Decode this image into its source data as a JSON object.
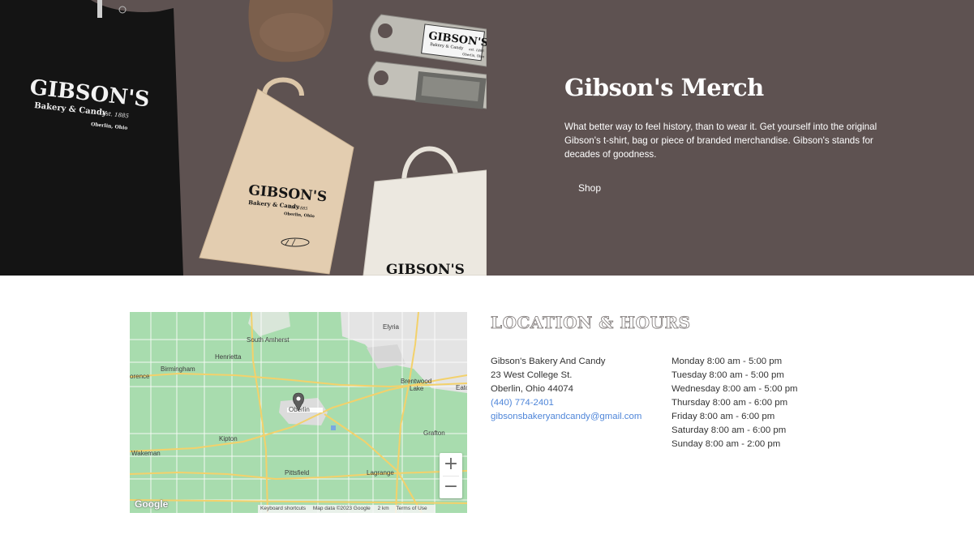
{
  "merch": {
    "title": "Gibson's Merch",
    "description": "What better way to feel history, than to wear it. Get yourself into the original Gibson's t-shirt, bag or piece of branded merchandise. Gibson's stands for decades of goodness.",
    "shop_label": "Shop",
    "image_text": {
      "shirt_brand": "GIBSON'S",
      "shirt_sub": "Bakery & Candy",
      "shirt_est": "est. 1885",
      "shirt_city": "Oberlin, Ohio",
      "tote_brand": "GIBSON'S",
      "tote_sub": "Bakery & Candy",
      "tote_est": "est. 1885",
      "tote_city": "Oberlin, Ohio",
      "opener_brand": "GIBSON'S",
      "opener_sub": "Bakery & Candy",
      "opener_est": "est. 1885",
      "opener_city": "Oberlin, Ohio",
      "tote2_brand": "GIBSON'S"
    },
    "colors": {
      "background": "#5e5251",
      "text": "#ffffff"
    }
  },
  "map": {
    "places": {
      "elyria": "Elyria",
      "south_amherst": "South Amherst",
      "henrietta": "Henrietta",
      "birmingham": "Birmingham",
      "florence": "orence",
      "brentwood_lake": "Brentwood",
      "brentwood_lake2": "Lake",
      "eaton": "Eato",
      "oberlin": "Oberlin",
      "kipton": "Kipton",
      "grafton": "Grafton",
      "wakeman": "Wakeman",
      "pittsfield": "Pittsfield",
      "lagrange": "Lagrange"
    },
    "zoom_in": "+",
    "zoom_out": "−",
    "google": "Google",
    "footer": {
      "shortcuts": "Keyboard shortcuts",
      "data": "Map data ©2023 Google",
      "scale": "2 km",
      "terms": "Terms of Use"
    }
  },
  "location": {
    "heading": "LOCATION & HOURS",
    "name": "Gibson's Bakery And Candy",
    "street": "23 West College St.",
    "city": "Oberlin, Ohio 44074",
    "phone": "(440) 774-2401",
    "email": "gibsonsbakeryandcandy@gmail.com",
    "hours": [
      "Monday 8:00 am - 5:00 pm",
      "Tuesday 8:00 am - 5:00 pm",
      "Wednesday 8:00 am - 5:00 pm",
      "Thursday 8:00 am - 6:00 pm",
      "Friday 8:00 am - 6:00 pm",
      "Saturday 8:00 am - 6:00 pm",
      "Sunday 8:00 am - 2:00 pm"
    ],
    "colors": {
      "link": "#4f86d9",
      "text": "#333333"
    }
  }
}
